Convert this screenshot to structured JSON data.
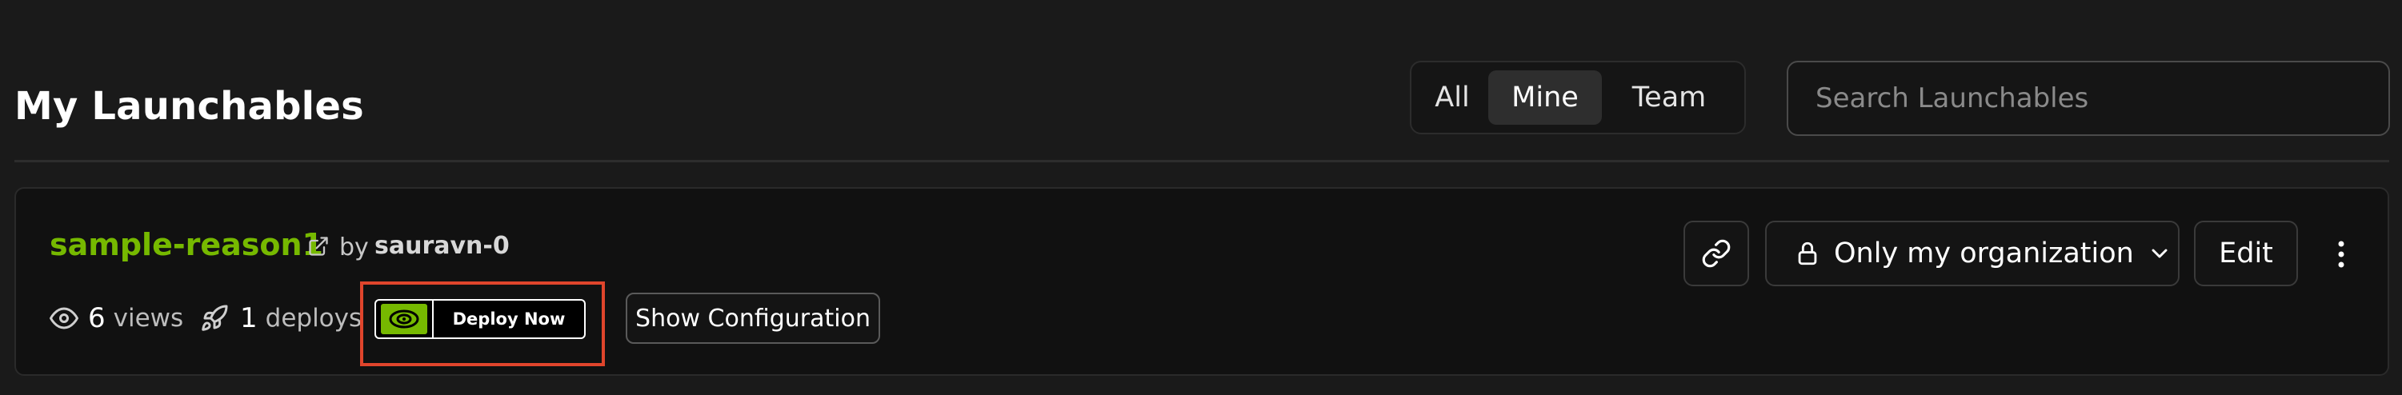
{
  "header": {
    "title": "My Launchables",
    "filters": [
      "All",
      "Mine",
      "Team"
    ],
    "active_filter": "Mine",
    "search_placeholder": "Search Launchables"
  },
  "launchable": {
    "name": "sample-reason1",
    "by_label": "by",
    "author": "sauravn-0",
    "views_count": "6",
    "views_label": "views",
    "deploys_count": "1",
    "deploys_label": "deploys",
    "deploy_button_label": "Deploy Now",
    "show_config_label": "Show Configuration",
    "visibility": "Only my organization",
    "edit_label": "Edit"
  },
  "icons": {
    "external_link": "external-link-icon",
    "views": "eye-icon",
    "deploys": "rocket-icon",
    "copy_link": "link-icon",
    "visibility": "lock-icon",
    "dropdown": "chevron-down-icon",
    "more": "more-vertical-icon",
    "brand": "nvidia-logo-icon"
  },
  "colors": {
    "accent": "#76b900",
    "highlight": "#e0452c",
    "background": "#1a1a1a",
    "card": "#111111"
  }
}
